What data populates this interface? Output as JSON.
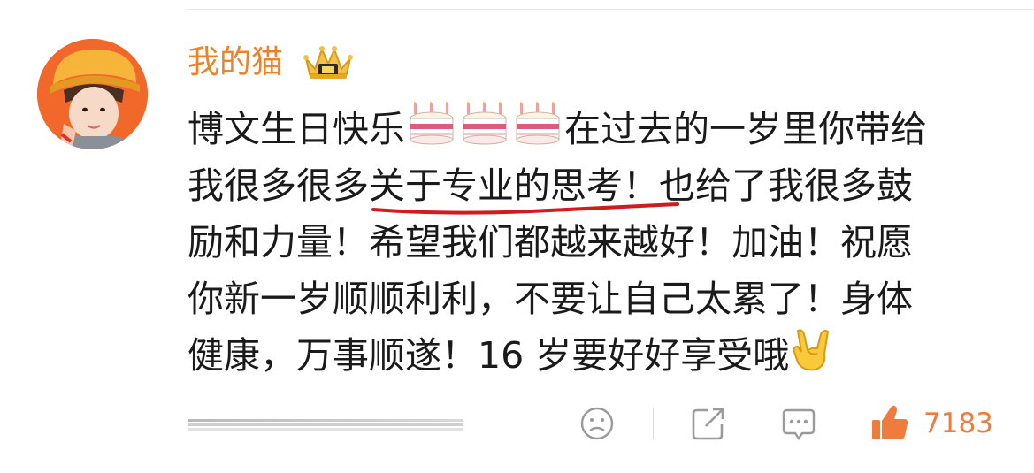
{
  "post": {
    "username": "我的猫",
    "comment_lines": [
      "博文生日快乐",
      "在过去的一岁里你带给",
      "我很多很多关于专业的思考！也给了我很多鼓",
      "励和力量！希望我们都越来越好！加油！祝愿",
      "你新一岁顺顺利利，不要让自己太累了！身体",
      "健康，万事顺遂！16 岁要好好享受哦"
    ]
  },
  "actions": {
    "like_count": "7183"
  },
  "icons": {
    "avatar": "avatar-photo",
    "crown": "crown-badge-icon",
    "cake": "birthday-cake-emoji",
    "rock_hand": "rock-on-hand-emoji",
    "emoji_reaction": "sad-face-icon",
    "share": "share-icon",
    "comment": "comment-icon",
    "like": "thumbs-up-icon"
  },
  "colors": {
    "username": "#f0802a",
    "like_count": "#ef7b3d",
    "underline": "#d01c1c",
    "text": "#1a1a1a",
    "icon_gray": "#9a9a9a"
  }
}
